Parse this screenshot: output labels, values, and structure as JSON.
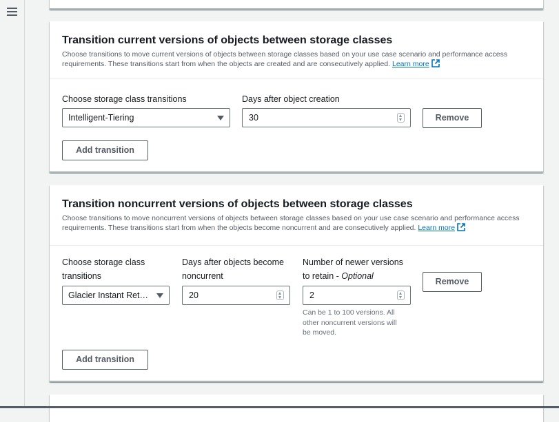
{
  "nav": {
    "menu_icon": "hamburger-menu-icon"
  },
  "current_section": {
    "title": "Transition current versions of objects between storage classes",
    "description": "Choose transitions to move current versions of objects between storage classes based on your use case scenario and performance access requirements. These transitions start from when the objects are created and are consecutively applied.",
    "learn_more": "Learn more",
    "storage_class_label": "Choose storage class transitions",
    "storage_class_value": "Intelligent-Tiering",
    "days_label": "Days after object creation",
    "days_value": "30",
    "remove_label": "Remove",
    "add_transition_label": "Add transition"
  },
  "noncurrent_section": {
    "title": "Transition noncurrent versions of objects between storage classes",
    "description": "Choose transitions to move noncurrent versions of objects between storage classes based on your use case scenario and performance access requirements. These transitions start from when the objects become noncurrent and are consecutively applied.",
    "learn_more": "Learn more",
    "storage_class_label_1": "Choose storage class",
    "storage_class_label_2": "transitions",
    "storage_class_value": "Glacier Instant Ret…",
    "days_label_1": "Days after objects become",
    "days_label_2": "noncurrent",
    "days_value": "20",
    "versions_label_1": "Number of newer versions",
    "versions_label_2": "to retain - ",
    "versions_label_optional": "Optional",
    "versions_value": "2",
    "versions_hint_1": "Can be 1 to 100 versions. All",
    "versions_hint_2": "other noncurrent versions will",
    "versions_hint_3": "be moved.",
    "remove_label": "Remove",
    "add_transition_label": "Add transition"
  },
  "colors": {
    "link": "#0073bb",
    "text": "#16191f",
    "muted": "#545b64",
    "border": "#687078"
  }
}
